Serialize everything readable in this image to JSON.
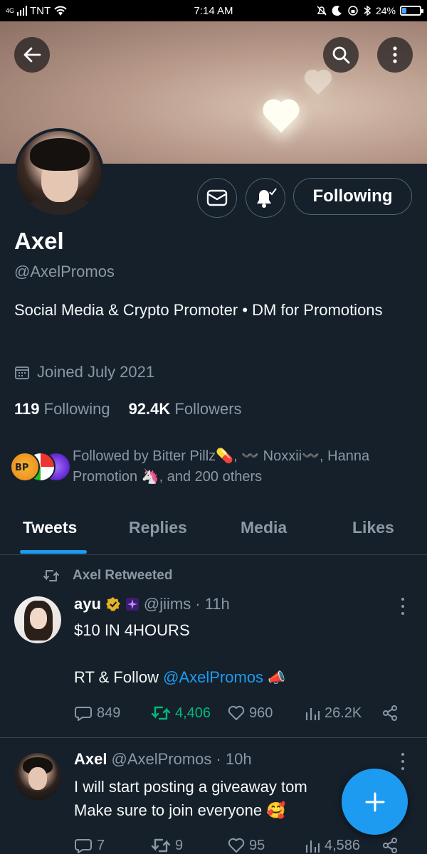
{
  "status_bar": {
    "signal": "4G",
    "carrier": "TNT",
    "time": "7:14 AM",
    "battery": "24%",
    "battery_level": 0.24
  },
  "profile": {
    "name": "Axel",
    "handle": "@AxelPromos",
    "bio": "Social Media & Crypto Promoter • DM for Promotions",
    "joined": "Joined July 2021",
    "following_count": "119",
    "following_label": "Following",
    "followers_count": "92.4K",
    "followers_label": "Followers",
    "followed_by": "Followed by Bitter Pillz💊, 〰️ Noxxii〰️, Hanna Promotion 🦄, and 200 others",
    "follow_button_label": "Following"
  },
  "tabs": [
    {
      "label": "Tweets",
      "active": true
    },
    {
      "label": "Replies",
      "active": false
    },
    {
      "label": "Media",
      "active": false
    },
    {
      "label": "Likes",
      "active": false
    }
  ],
  "tweets": [
    {
      "retweeted_by": "Axel Retweeted",
      "name": "ayu",
      "handle": "@jiims",
      "time": "· 11h",
      "line1": "$10 IN 4HOURS",
      "line2_prefix": "RT & Follow ",
      "mention": "@AxelPromos",
      "emoji": "📣",
      "replies": "849",
      "retweets": "4,406",
      "likes": "960",
      "views": "26.2K"
    },
    {
      "name": "Axel",
      "handle": "@AxelPromos",
      "time": "· 10h",
      "line1": "I will start posting a giveaway tom",
      "line2": "Make sure to join everyone 🥰",
      "replies": "7",
      "retweets": "9",
      "likes": "95",
      "views": "4,586"
    }
  ],
  "colors": {
    "background": "#15202b",
    "accent": "#1d9bf0",
    "retweet_green": "#00ba7c",
    "muted_text": "#8b98a5",
    "border": "#38444d"
  },
  "icons": [
    "back-arrow-icon",
    "search-icon",
    "more-vertical-icon",
    "mail-icon",
    "notification-bell-icon",
    "calendar-icon",
    "retweet-icon",
    "verified-badge-icon",
    "reply-icon",
    "like-icon",
    "views-icon",
    "share-icon",
    "compose-plus-icon"
  ]
}
